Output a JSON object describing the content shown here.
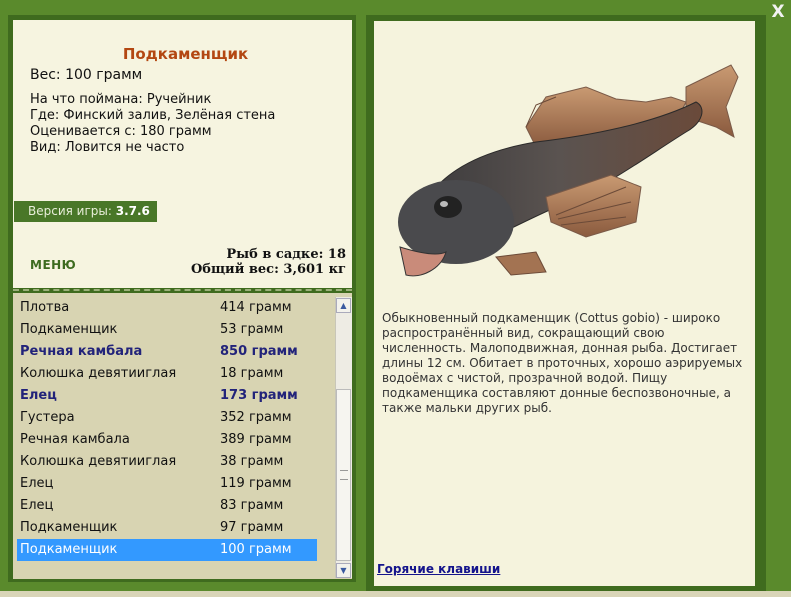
{
  "window": {
    "close_label": "X"
  },
  "fish": {
    "name": "Подкаменщик",
    "weight_text": "Вес: 100 грамм",
    "details": [
      "На что поймана: Ручейник",
      "Где: Финский залив, Зелёная стена",
      "Оценивается с: 180 грамм",
      "Вид: Ловится не часто"
    ]
  },
  "version": {
    "label": "Версия игры:",
    "value": "3.7.6"
  },
  "menu_label": "МЕНЮ",
  "stats": {
    "count_text": "Рыб в садке: 18",
    "total_weight_text": "Общий вес: 3,601 кг"
  },
  "catch_list": [
    {
      "name": "Плотва",
      "weight": "414 грамм",
      "bold": false,
      "selected": false
    },
    {
      "name": "Подкаменщик",
      "weight": "53 грамм",
      "bold": false,
      "selected": false
    },
    {
      "name": "Речная камбала",
      "weight": "850 грамм",
      "bold": true,
      "selected": false
    },
    {
      "name": "Колюшка девятииглая",
      "weight": "18 грамм",
      "bold": false,
      "selected": false
    },
    {
      "name": "Елец",
      "weight": "173 грамм",
      "bold": true,
      "selected": false
    },
    {
      "name": "Густера",
      "weight": "352 грамм",
      "bold": false,
      "selected": false
    },
    {
      "name": "Речная камбала",
      "weight": "389 грамм",
      "bold": false,
      "selected": false
    },
    {
      "name": "Колюшка девятииглая",
      "weight": "38 грамм",
      "bold": false,
      "selected": false
    },
    {
      "name": "Елец",
      "weight": "119 грамм",
      "bold": false,
      "selected": false
    },
    {
      "name": "Елец",
      "weight": "83 грамм",
      "bold": false,
      "selected": false
    },
    {
      "name": "Подкаменщик",
      "weight": "97 грамм",
      "bold": false,
      "selected": false
    },
    {
      "name": "Подкаменщик",
      "weight": "100 грамм",
      "bold": false,
      "selected": true
    }
  ],
  "scrollbar": {
    "up_icon": "arrow-up-icon",
    "down_icon": "arrow-down-icon"
  },
  "description": "Обыкновенный подкаменщик (Cottus gobio) - широко распространённый вид, сокращающий свою численность. Малоподвижная, донная рыба. Достигает длины 12 см. Обитает в проточных, хорошо аэрируемых водоёмах с чистой, прозрачной водой. Пищу подкаменщика составляют донные беспозвоночные, а также мальки других рыб.",
  "hotkeys_label": "Горячие клавиши",
  "colors": {
    "frame_green": "#3f6b1e",
    "panel_cream": "#f6f4e0",
    "list_bg": "#d8d4b2",
    "title_orange": "#b34712",
    "selection_blue": "#3399ff",
    "link_blue": "#14148c"
  }
}
